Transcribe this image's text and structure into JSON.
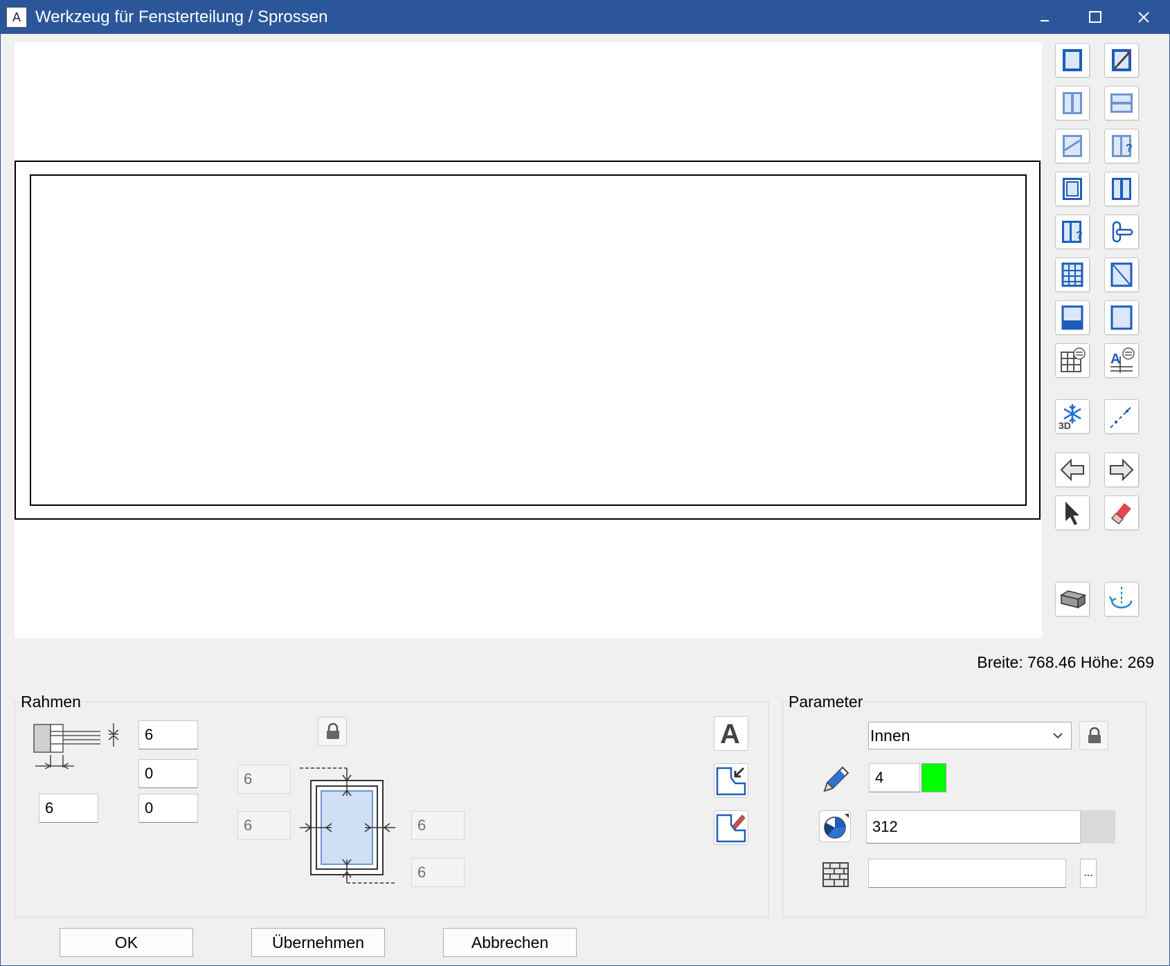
{
  "window": {
    "title": "Werkzeug für Fensterteilung / Sprossen",
    "app_icon_glyph": "A",
    "controls": [
      "minimize-icon",
      "maximize-icon",
      "close-icon"
    ]
  },
  "canvas": {
    "status": "Breite: 768.46 Höhe: 269"
  },
  "toolbar": {
    "buttons": [
      "single-pane-icon",
      "edit-pane-icon",
      "split-vertical-icon",
      "split-horizontal-icon",
      "diagonal-split-icon",
      "split-query-icon",
      "sash-icon",
      "double-sash-icon",
      "sash-query-icon",
      "handle-icon",
      "grid-bars-icon",
      "triangle-pane-icon",
      "bottom-panel-icon",
      "fixed-pane-icon",
      "grid-settings-icon",
      "text-settings-icon",
      "3d-snowflake-icon",
      "dashed-line-icon",
      "arrow-left-icon",
      "arrow-right-icon",
      "select-pointer-icon",
      "eraser-icon",
      "box-3d-icon",
      "rotate-axis-icon"
    ]
  },
  "rahmen": {
    "title": "Rahmen",
    "profile_height": "6",
    "profile_offset_a": "0",
    "profile_width": "6",
    "profile_offset_b": "0",
    "inset_top": "6",
    "inset_left": "6",
    "inset_right": "6",
    "inset_bottom": "6"
  },
  "parameter": {
    "title": "Parameter",
    "position_selected": "Innen",
    "pen": "4",
    "color_code": "312",
    "material": "",
    "more_label": "...",
    "pen_color": "#00ff00"
  },
  "buttons": {
    "ok": "OK",
    "apply": "Übernehmen",
    "cancel": "Abbrechen"
  }
}
